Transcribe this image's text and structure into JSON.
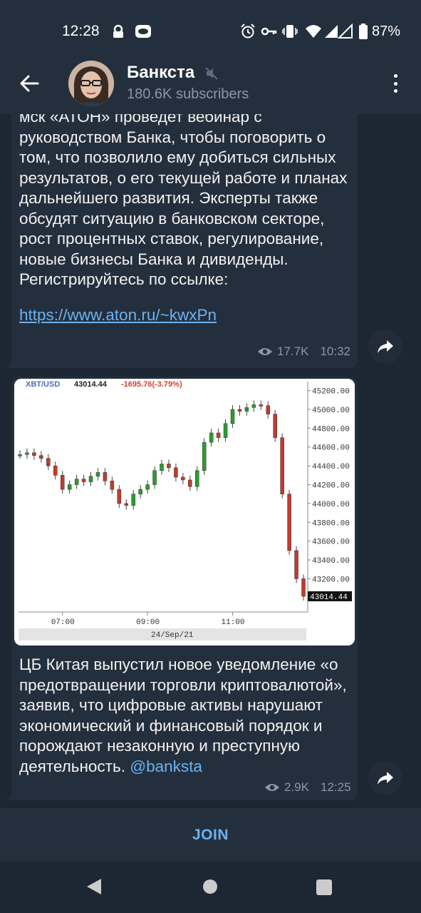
{
  "status_bar": {
    "time": "12:28",
    "battery": "87%",
    "icons": [
      "lock-icon",
      "face-icon",
      "alarm-icon",
      "key-icon",
      "vibrate-icon",
      "wifi-icon",
      "signal-icon",
      "signal-icon",
      "battery-icon"
    ]
  },
  "header": {
    "channel_name": "Банкста",
    "subscribers": "180.6K subscribers",
    "muted": true
  },
  "messages": [
    {
      "text": "мск «АТОН» проведет вебинар с руководством Банка, чтобы поговорить о том, что позволило ему добиться сильных результатов, о его текущей работе и планах дальнейшего развития. Эксперты также обсудят ситуацию в банковском секторе, рост процентных ставок, регулирование, новые бизнесы Банка и дивиденды. Регистрируйтесь по ссылке:",
      "link": "https://www.aton.ru/~kwxPn",
      "views": "17.7K",
      "time": "10:32"
    },
    {
      "chart": {
        "symbol": "XBT/USD",
        "price": "43014.44",
        "change": "-1695.76(-3.79%)",
        "last_label": "43014.44",
        "date_label": "24/Sep/21"
      },
      "text": "ЦБ Китая выпустил новое уведомление «о предотвращении торговли криптовалютой», заявив, что цифровые активы нарушают экономический и финансовый порядок и порождают незаконную и преступную деятельность.",
      "mention": "@banksta",
      "views": "2.9K",
      "time": "12:25"
    }
  ],
  "chart_data": {
    "type": "line",
    "title": "XBT/USD 43014.44 -1695.76(-3.79%)",
    "xlabel": "",
    "ylabel": "",
    "x_ticks": [
      "07:00",
      "09:00",
      "11:00"
    ],
    "y_ticks": [
      43200,
      43400,
      43600,
      43800,
      44000,
      44200,
      44400,
      44600,
      44800,
      45000,
      45200
    ],
    "ylim": [
      42900,
      45250
    ],
    "x": [
      "06:00",
      "06:10",
      "06:20",
      "06:30",
      "06:40",
      "06:50",
      "07:00",
      "07:10",
      "07:20",
      "07:30",
      "07:40",
      "07:50",
      "08:00",
      "08:10",
      "08:20",
      "08:30",
      "08:40",
      "08:50",
      "09:00",
      "09:10",
      "09:20",
      "09:30",
      "09:40",
      "09:50",
      "10:00",
      "10:10",
      "10:20",
      "10:30",
      "10:40",
      "10:50",
      "11:00",
      "11:10",
      "11:20",
      "11:30",
      "11:40",
      "11:50",
      "12:00",
      "12:10",
      "12:20",
      "12:30",
      "12:40"
    ],
    "series": [
      {
        "name": "XBT/USD",
        "values": [
          44520,
          44540,
          44510,
          44480,
          44400,
          44300,
          44150,
          44200,
          44260,
          44230,
          44290,
          44330,
          44240,
          44150,
          44000,
          43980,
          44100,
          44150,
          44200,
          44350,
          44420,
          44380,
          44280,
          44250,
          44180,
          44350,
          44650,
          44750,
          44700,
          44850,
          45000,
          44980,
          45020,
          45050,
          45040,
          44950,
          44700,
          44100,
          43500,
          43200,
          43014
        ]
      }
    ],
    "grid": false
  },
  "join": {
    "label": "JOIN"
  }
}
